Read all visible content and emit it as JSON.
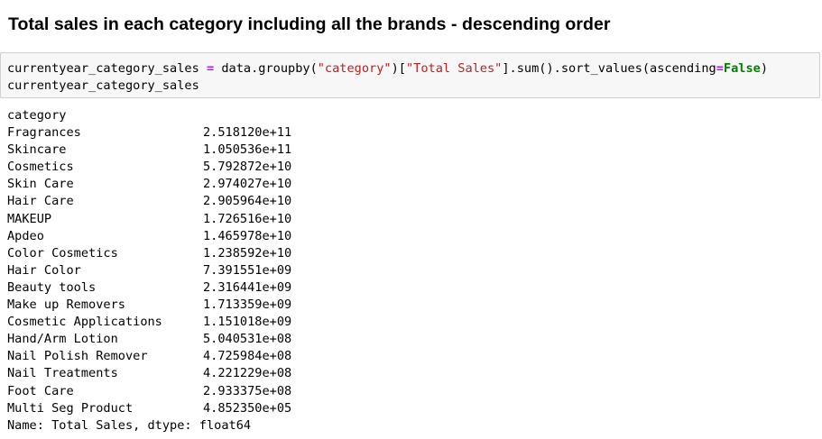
{
  "heading": "Total sales in each category including all the brands - descending order",
  "code": {
    "line1": {
      "var": "currentyear_category_sales ",
      "op_eq": "=",
      "call_a": " data.groupby(",
      "str_a": "\"category\"",
      "call_b": ")[",
      "str_b": "\"Total Sales\"",
      "call_c": "].sum().sort_values(ascending",
      "op_kw": "=",
      "kw_false": "False",
      "call_d": ")"
    },
    "line2": "currentyear_category_sales"
  },
  "output": {
    "index_name": "category",
    "rows": [
      {
        "category": "Fragrances",
        "value": "2.518120e+11"
      },
      {
        "category": "Skincare",
        "value": "1.050536e+11"
      },
      {
        "category": "Cosmetics",
        "value": "5.792872e+10"
      },
      {
        "category": "Skin Care",
        "value": "2.974027e+10"
      },
      {
        "category": "Hair Care",
        "value": "2.905964e+10"
      },
      {
        "category": "MAKEUP",
        "value": "1.726516e+10"
      },
      {
        "category": "Apdeo",
        "value": "1.465978e+10"
      },
      {
        "category": "Color Cosmetics",
        "value": "1.238592e+10"
      },
      {
        "category": "Hair Color",
        "value": "7.391551e+09"
      },
      {
        "category": "Beauty tools",
        "value": "2.316441e+09"
      },
      {
        "category": "Make up Removers",
        "value": "1.713359e+09"
      },
      {
        "category": "Cosmetic Applications",
        "value": "1.151018e+09"
      },
      {
        "category": "Hand/Arm Lotion",
        "value": "5.040531e+08"
      },
      {
        "category": "Nail Polish Remover",
        "value": "4.725984e+08"
      },
      {
        "category": "Nail Treatments",
        "value": "4.221229e+08"
      },
      {
        "category": "Foot Care",
        "value": "2.933375e+08"
      },
      {
        "category": "Multi Seg Product",
        "value": "4.852350e+05"
      }
    ],
    "footer": "Name: Total Sales, dtype: float64"
  },
  "colors": {
    "operator": "#aa22ff",
    "string": "#ba2121",
    "keyword": "#008000",
    "cell_background": "#f7f7f7",
    "cell_border": "#cfcfcf"
  }
}
